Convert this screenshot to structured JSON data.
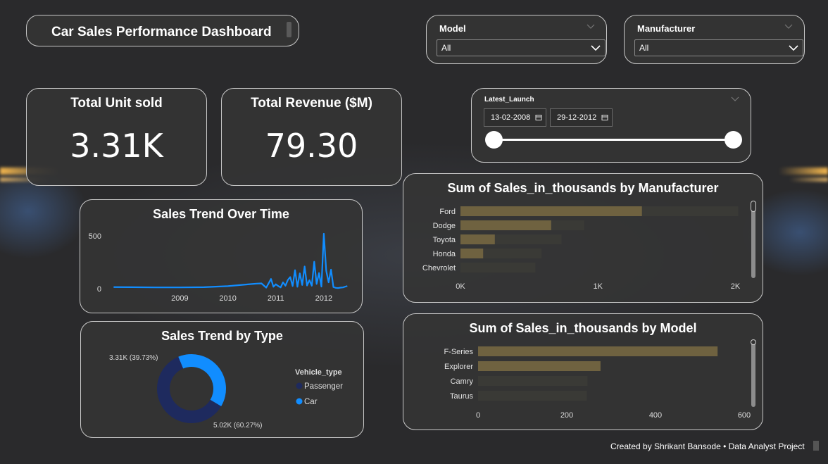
{
  "header": {
    "title": "Car Sales Performance Dashboard"
  },
  "filters": {
    "model": {
      "label": "Model",
      "value": "All"
    },
    "manufacturer": {
      "label": "Manufacturer",
      "value": "All"
    },
    "latest_launch": {
      "label": "Latest_Launch",
      "start": "13-02-2008",
      "end": "29-12-2012"
    }
  },
  "kpis": {
    "units": {
      "label": "Total Unit sold",
      "value": "3.31K"
    },
    "revenue": {
      "label": "Total Revenue ($M)",
      "value": "79.30"
    }
  },
  "footer": {
    "credit": "Created by Shrikant Bansode • Data Analyst Project"
  },
  "colors": {
    "accent": "#118dff",
    "bar": "#6f6240",
    "bar_track": "#3a3a36",
    "donut_dark": "#1e2a5e"
  },
  "chart_data": [
    {
      "type": "line",
      "title": "Sales Trend Over Time",
      "xlabel": "",
      "ylabel": "",
      "x_ticks": [
        "2009",
        "2010",
        "2011",
        "2012"
      ],
      "y_ticks": [
        0,
        500
      ],
      "ylim": [
        0,
        560
      ],
      "x": [
        2008.12,
        2008.5,
        2009,
        2009.5,
        2010,
        2010.5,
        2011,
        2011.1,
        2011.2,
        2011.3,
        2011.4,
        2011.45,
        2011.5,
        2011.55,
        2011.6,
        2011.65,
        2011.7,
        2011.75,
        2011.8,
        2011.85,
        2011.9,
        2011.95,
        2012,
        2012.05,
        2012.1,
        2012.15,
        2012.2,
        2012.25,
        2012.3,
        2012.35,
        2012.4,
        2012.45,
        2012.5,
        2012.55,
        2012.6,
        2012.65,
        2012.7,
        2012.75,
        2012.8,
        2012.85,
        2012.9,
        2012.95,
        2012.99
      ],
      "y": [
        15,
        14,
        12,
        12,
        14,
        24,
        44,
        48,
        50,
        10,
        92,
        18,
        42,
        25,
        12,
        60,
        28,
        82,
        110,
        25,
        175,
        18,
        145,
        35,
        210,
        30,
        80,
        28,
        255,
        45,
        148,
        20,
        520,
        170,
        60,
        180,
        15,
        8,
        6,
        10,
        12,
        20,
        25
      ]
    },
    {
      "type": "pie",
      "title": "Sales Trend by Type",
      "legend_title": "Vehicle_type",
      "legend_position": "right",
      "slices": [
        {
          "name": "Passenger",
          "value": 5.02,
          "label": "5.02K (60.27%)",
          "color": "#1e2a5e"
        },
        {
          "name": "Car",
          "value": 3.31,
          "label": "3.31K (39.73%)",
          "color": "#118dff"
        }
      ]
    },
    {
      "type": "bar",
      "title": "Sum of Sales_in_thousands by Manufacturer",
      "categories": [
        "Ford",
        "Dodge",
        "Toyota",
        "Honda",
        "Chevrolet"
      ],
      "values": [
        1320,
        660,
        250,
        165,
        0
      ],
      "track_values": [
        2020,
        900,
        735,
        590,
        545
      ],
      "x_ticks": [
        "0K",
        "1K",
        "2K"
      ],
      "xlim": [
        0,
        2100
      ]
    },
    {
      "type": "bar",
      "title": "Sum of Sales_in_thousands by Model",
      "categories": [
        "F-Series",
        "Explorer",
        "Camry",
        "Taurus"
      ],
      "values": [
        540,
        276,
        0,
        0
      ],
      "track_values": [
        540,
        276,
        247,
        245
      ],
      "x_ticks": [
        "0",
        "200",
        "400",
        "600"
      ],
      "xlim": [
        0,
        600
      ]
    }
  ]
}
